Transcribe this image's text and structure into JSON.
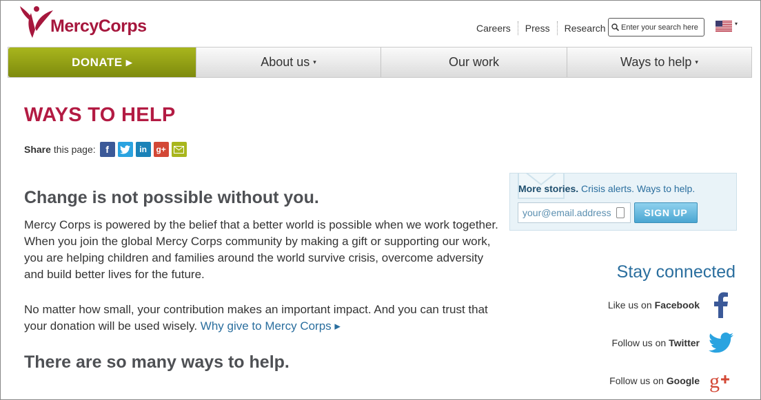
{
  "brand": {
    "name": "MercyCorps",
    "accent": "#a6173d"
  },
  "toplinks": [
    "Careers",
    "Press",
    "Research"
  ],
  "search": {
    "placeholder": "Enter your search here"
  },
  "nav": {
    "donate": "DONATE ▸",
    "about": "About us",
    "work": "Our work",
    "ways": "Ways to help",
    "caret": "▾"
  },
  "main": {
    "title": "WAYS TO HELP",
    "share_bold": "Share",
    "share_rest": "this page:",
    "headline": "Change is not possible without you.",
    "para1": "Mercy Corps is powered by the belief that a better world is possible when we work together. When you join the global Mercy Corps community by making a gift or supporting our work, you are helping children and families around the world survive crisis, overcome adversity and build better lives for the future.",
    "para2": "No matter how small, your contribution makes an important impact. And you can trust that your donation will be used wisely.",
    "para2_link": "Why give to Mercy Corps ▸",
    "subheadline": "There are so many ways to help."
  },
  "signup": {
    "bold": "More stories.",
    "rest": "Crisis alerts. Ways to help.",
    "placeholder": "your@email.address",
    "button": "SIGN UP"
  },
  "social": {
    "title": "Stay connected",
    "items": [
      {
        "prefix": "Like us on",
        "name": "Facebook",
        "icon": "facebook-icon"
      },
      {
        "prefix": "Follow us on",
        "name": "Twitter",
        "icon": "twitter-icon"
      },
      {
        "prefix": "Follow us on",
        "name": "Google",
        "icon": "google-plus-icon"
      }
    ]
  },
  "colors": {
    "title": "#b31b43",
    "link": "#2a6e9e",
    "donate": "#97a519"
  }
}
